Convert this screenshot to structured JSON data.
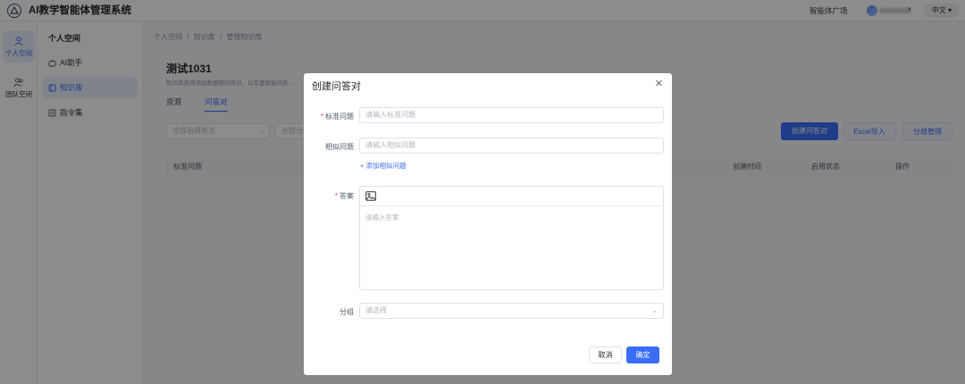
{
  "app": {
    "title": "AI教学智能体管理系统"
  },
  "header": {
    "agent_plaza": "智能体广场",
    "language": "中文 ▾"
  },
  "rail": {
    "items": [
      {
        "label": "个人空间"
      },
      {
        "label": "团队空间"
      }
    ]
  },
  "subnav": {
    "title": "个人空间",
    "items": [
      {
        "label": "AI助手"
      },
      {
        "label": "知识库"
      },
      {
        "label": "指令集"
      }
    ]
  },
  "breadcrumb": {
    "items": [
      "个人空间",
      "/",
      "知识库",
      "/",
      "管理知识库"
    ]
  },
  "page": {
    "title": "测试1031",
    "description": "知识库支持添加数据和问答对，以丰富智能问答..."
  },
  "tabs": [
    {
      "label": "资源"
    },
    {
      "label": "问答对"
    }
  ],
  "filters": {
    "status_placeholder": "全部启用状态",
    "group_placeholder": "全部分组"
  },
  "actions": {
    "create": "创建问答对",
    "excel_import": "Excel导入",
    "group_manage": "分组管理"
  },
  "table": {
    "headers": {
      "question": "标准问题",
      "created": "创建时间",
      "status": "启用状态",
      "ops": "操作"
    }
  },
  "modal": {
    "title": "创建问答对",
    "fields": {
      "standard_question": {
        "label": "标准问题",
        "placeholder": "请输入标准问题"
      },
      "similar_question": {
        "label": "相似问题",
        "placeholder": "请输入相似问题"
      },
      "add_similar": "+ 添加相似问题",
      "answer": {
        "label": "答案",
        "placeholder": "请输入答案"
      },
      "group": {
        "label": "分组",
        "placeholder": "请选择"
      }
    },
    "cancel": "取消",
    "confirm": "确定"
  },
  "colors": {
    "primary": "#3b6cf6",
    "required": "#f53f3f"
  }
}
